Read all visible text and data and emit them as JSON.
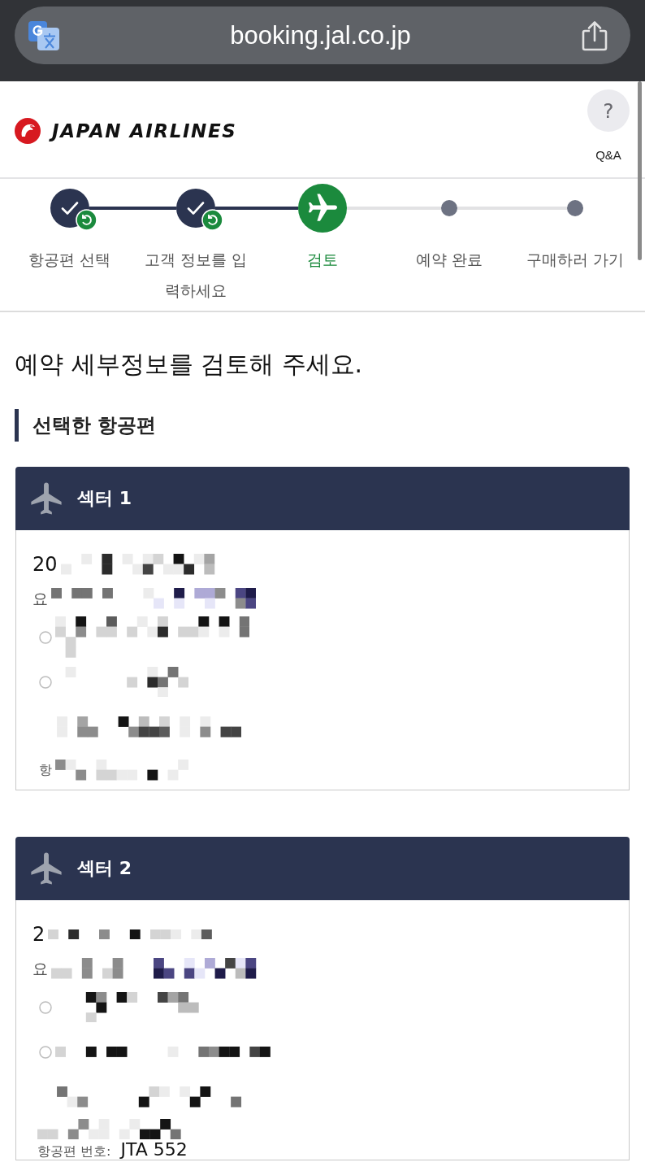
{
  "browser": {
    "url": "booking.jal.co.jp"
  },
  "header": {
    "brand": "JAPAN AIRLINES",
    "help_label": "?",
    "qa_label": "Q&A"
  },
  "steps": [
    {
      "label": "항공편 선택",
      "selected": false
    },
    {
      "label": "고객 정보를 입력하세요",
      "selected": false
    },
    {
      "label": "검토",
      "selected": true
    },
    {
      "label": "예약 완료",
      "selected": false
    },
    {
      "label": "구매하러 가기",
      "selected": false
    }
  ],
  "page_title": "예약 세부정보를 검토해 주세요.",
  "section_title": "선택한 항공편",
  "sectors": [
    {
      "title": "섹터 1",
      "rows": [
        {
          "kind": "date",
          "text": "20"
        },
        {
          "kind": "label",
          "text": "요"
        },
        {
          "kind": "option"
        },
        {
          "kind": "option"
        },
        {
          "kind": "detail"
        },
        {
          "kind": "flight",
          "label": "항"
        }
      ]
    },
    {
      "title": "섹터 2",
      "rows": [
        {
          "kind": "date",
          "text": "2"
        },
        {
          "kind": "label",
          "text": "요"
        },
        {
          "kind": "option"
        },
        {
          "kind": "option"
        },
        {
          "kind": "detail"
        },
        {
          "kind": "flight",
          "label": "항공편 번호:",
          "value": "JTA 552"
        }
      ]
    }
  ]
}
